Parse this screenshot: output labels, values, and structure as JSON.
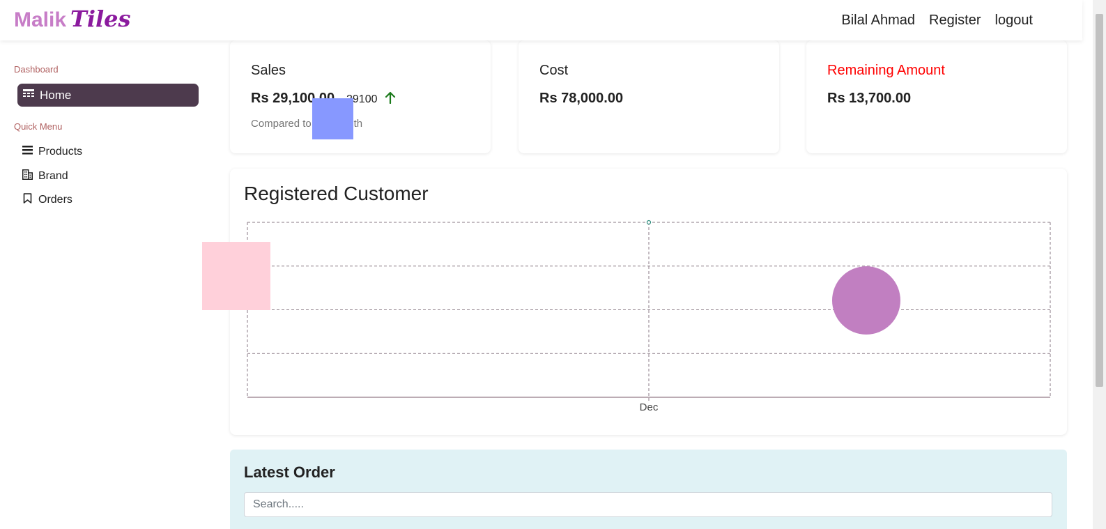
{
  "brand": {
    "part1": "Malik",
    "part2": "Tiles"
  },
  "topnav": {
    "user": "Bilal Ahmad",
    "register": "Register",
    "logout": "logout"
  },
  "sidebar": {
    "section_dashboard": "Dashboard",
    "home": "Home",
    "section_quick": "Quick Menu",
    "items": [
      {
        "label": "Products",
        "icon": "list-icon"
      },
      {
        "label": "Brand",
        "icon": "building-icon"
      },
      {
        "label": "Orders",
        "icon": "bookmark-icon"
      }
    ]
  },
  "cards": {
    "sales": {
      "title": "Sales",
      "value": "Rs 29,100.00",
      "change": "29100",
      "compare": "Compared to last month"
    },
    "cost": {
      "title": "Cost",
      "value": "Rs 78,000.00"
    },
    "remaining": {
      "title": "Remaining Amount",
      "value": "Rs 13,700.00",
      "title_color": "#ff0000"
    }
  },
  "chart": {
    "title": "Registered Customer",
    "chart_data": {
      "type": "line",
      "categories": [
        "Dec"
      ],
      "series": [
        {
          "values": [
            4
          ]
        }
      ],
      "ylim": [
        0,
        4
      ],
      "grid": true,
      "xlabel": "",
      "ylabel": ""
    }
  },
  "latest_order": {
    "title": "Latest Order",
    "search_placeholder": "Search....."
  },
  "colors": {
    "home_bg": "#4d3a4d",
    "brand_pink": "#c77dc7",
    "brand_purple": "#8b1a9e",
    "order_bg": "#e0f2f5"
  }
}
